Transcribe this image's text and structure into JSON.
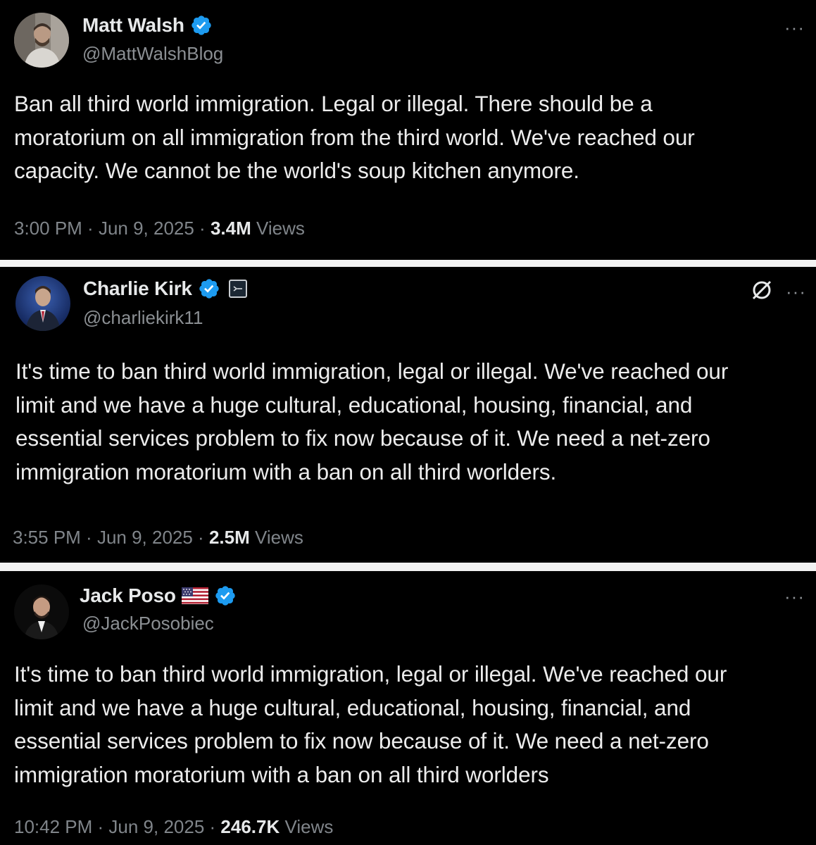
{
  "tweets": [
    {
      "display_name": "Matt Walsh",
      "handle": "@MattWalshBlog",
      "text": "Ban all third world immigration. Legal or illegal. There should be a\nmoratorium on all immigration from the third world. We've reached our\ncapacity. We cannot be the world's soup kitchen anymore.",
      "time": "3:00 PM",
      "date": "Jun 9, 2025",
      "views": "3.4M",
      "views_label": "Views",
      "more": "···",
      "badges": [
        "verified-icon"
      ]
    },
    {
      "display_name": "Charlie Kirk",
      "handle": "@charliekirk11",
      "text": "It's time to ban third world immigration, legal or illegal. We've reached our\nlimit and we have a huge cultural, educational, housing, financial, and\nessential services problem to fix now because of it. We need a net-zero\nimmigration moratorium with a ban on all third worlders.",
      "time": "3:55 PM",
      "date": "Jun 9, 2025",
      "views": "2.5M",
      "views_label": "Views",
      "more": "···",
      "badges": [
        "verified-icon",
        "affiliation-badge-icon",
        "grok-icon"
      ]
    },
    {
      "display_name": "Jack Poso",
      "handle": "@JackPosobiec",
      "text": "It's time to ban third world immigration, legal or illegal. We've reached our\nlimit and we have a huge cultural, educational, housing, financial, and\nessential services problem to fix now because of it. We need a net-zero\nimmigration moratorium with a ban on all third worlders",
      "time": "10:42 PM",
      "date": "Jun 9, 2025",
      "views": "246.7K",
      "views_label": "Views",
      "more": "···",
      "badges": [
        "us-flag-icon",
        "verified-icon"
      ]
    }
  ],
  "separator": " · ",
  "colors": {
    "background": "#000000",
    "text": "#e7e9ea",
    "muted": "#8b8f93",
    "verified_blue": "#1d9bf0",
    "divider": "#f2f2f2"
  }
}
